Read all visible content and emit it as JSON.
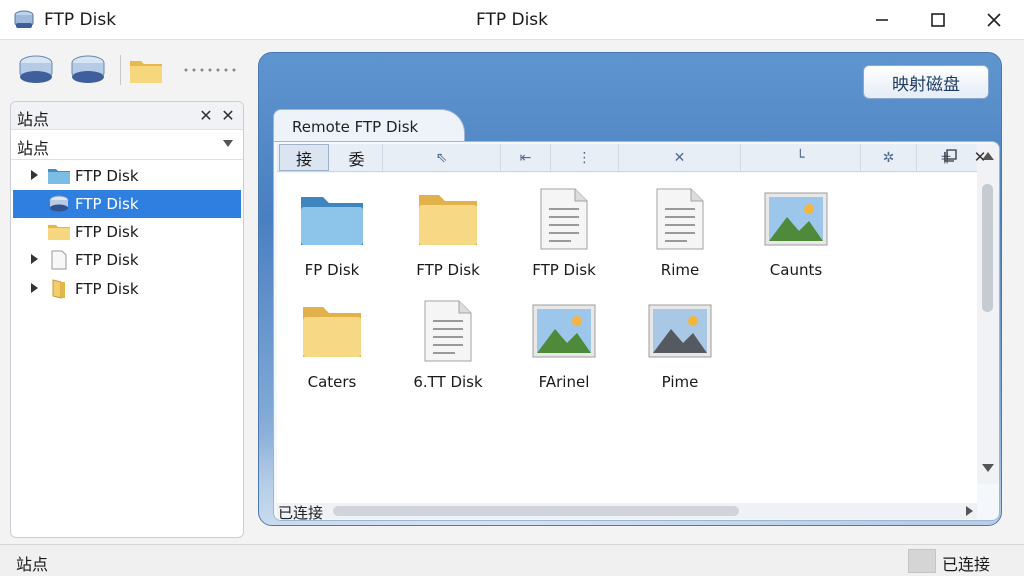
{
  "window": {
    "title": "FTP Disk",
    "center_title": "FTP Disk",
    "controls": [
      "minimize",
      "maximize",
      "close"
    ]
  },
  "toolbar": {
    "items": [
      {
        "name": "disk-drive-icon",
        "icon": "disk-drive-icon"
      },
      {
        "name": "disk-drive-icon-2",
        "icon": "disk-drive-icon"
      },
      {
        "name": "folder-icon",
        "icon": "folder-icon"
      },
      {
        "name": "more-dots",
        "icon": "more-icon"
      }
    ]
  },
  "sites_panel": {
    "title": "站点",
    "filter_value": "站点",
    "items": [
      {
        "label": "FTP Disk",
        "icon": "folder-blue-icon",
        "expandable": true,
        "selected": false
      },
      {
        "label": "FTP Disk",
        "icon": "disk-drive-icon",
        "expandable": false,
        "selected": true
      },
      {
        "label": "FTP Disk",
        "icon": "folder-icon",
        "expandable": false,
        "selected": false
      },
      {
        "label": "FTP Disk",
        "icon": "document-icon",
        "expandable": true,
        "selected": false
      },
      {
        "label": "FTP Disk",
        "icon": "folder-open-icon",
        "expandable": true,
        "selected": false
      }
    ]
  },
  "main": {
    "map_button_label": "映射磁盘",
    "inner_window": {
      "tab_label": "Remote FTP Disk",
      "toolbar": {
        "text_buttons": [
          "接",
          "委"
        ],
        "icon_buttons": [
          "arrow-upleft-icon",
          "arrow-left-icon",
          "more-vertical-icon",
          "close-small-icon",
          "corner-icon",
          "sparkle-icon",
          "grid-icon"
        ]
      },
      "files": [
        {
          "label": "FP Disk",
          "icon": "folder-blue-icon"
        },
        {
          "label": "FTP Disk",
          "icon": "folder-icon"
        },
        {
          "label": "FTP Disk",
          "icon": "document-icon"
        },
        {
          "label": "Rime",
          "icon": "document-icon"
        },
        {
          "label": "Caunts",
          "icon": "image-icon"
        },
        {
          "label": "Caters",
          "icon": "folder-icon"
        },
        {
          "label": "6.TT Disk",
          "icon": "document-icon"
        },
        {
          "label": "FArinel",
          "icon": "image-icon"
        },
        {
          "label": "Pime",
          "icon": "image-icon"
        }
      ],
      "status_text": "已连接"
    }
  },
  "statusbar": {
    "left_text": "站点",
    "right_text": "已连接"
  },
  "colors": {
    "selection": "#2f7fe0",
    "main_blue": "#4a7fc0",
    "folder_yellow": "#f4d47a",
    "folder_blue": "#6fb0dc"
  }
}
